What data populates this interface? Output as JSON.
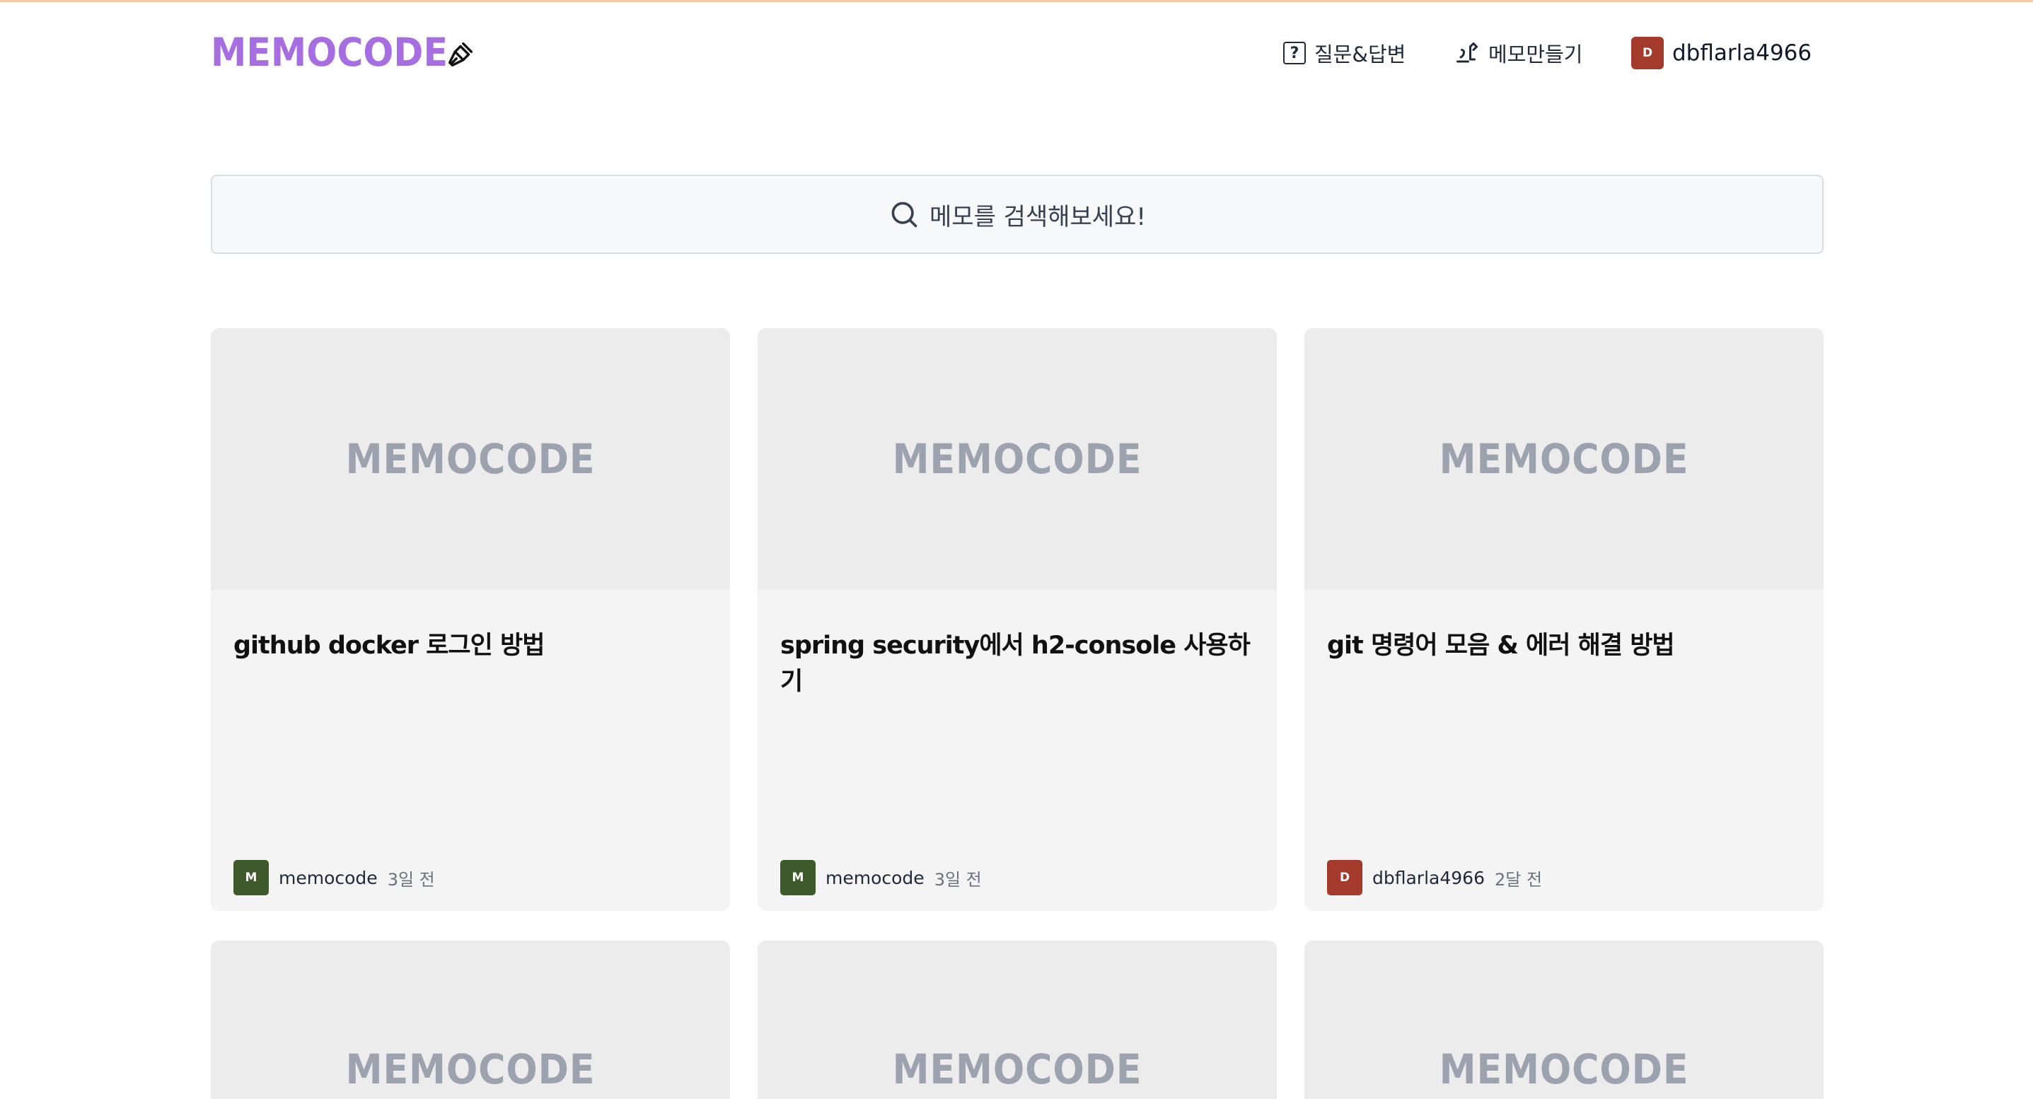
{
  "brand": {
    "name": "MEMOCODE",
    "logo_icon": "brush-icon",
    "color": "#a66ee0"
  },
  "nav": {
    "qa_label": "질문&답변",
    "qa_icon": "question-icon",
    "create_label": "메모만들기",
    "create_icon": "pen-icon",
    "user_initial": "D",
    "user_name": "dbflarla4966"
  },
  "search": {
    "placeholder": "메모를 검색해보세요!",
    "icon": "search-icon"
  },
  "cards": [
    {
      "thumb": "MEMOCODE",
      "title": "github docker 로그인 방법",
      "author_initial": "M",
      "author": "memocode",
      "time": "3일 전",
      "avatar_color": "#3f5a2a"
    },
    {
      "thumb": "MEMOCODE",
      "title": "spring security에서 h2-console 사용하기",
      "author_initial": "M",
      "author": "memocode",
      "time": "3일 전",
      "avatar_color": "#3f5a2a"
    },
    {
      "thumb": "MEMOCODE",
      "title": "git 명령어 모음 & 에러 해결 방법",
      "author_initial": "D",
      "author": "dbflarla4966",
      "time": "2달 전",
      "avatar_color": "#a33a2c"
    },
    {
      "thumb": "MEMOCODE"
    },
    {
      "thumb": "MEMOCODE"
    },
    {
      "thumb": "MEMOCODE"
    }
  ]
}
